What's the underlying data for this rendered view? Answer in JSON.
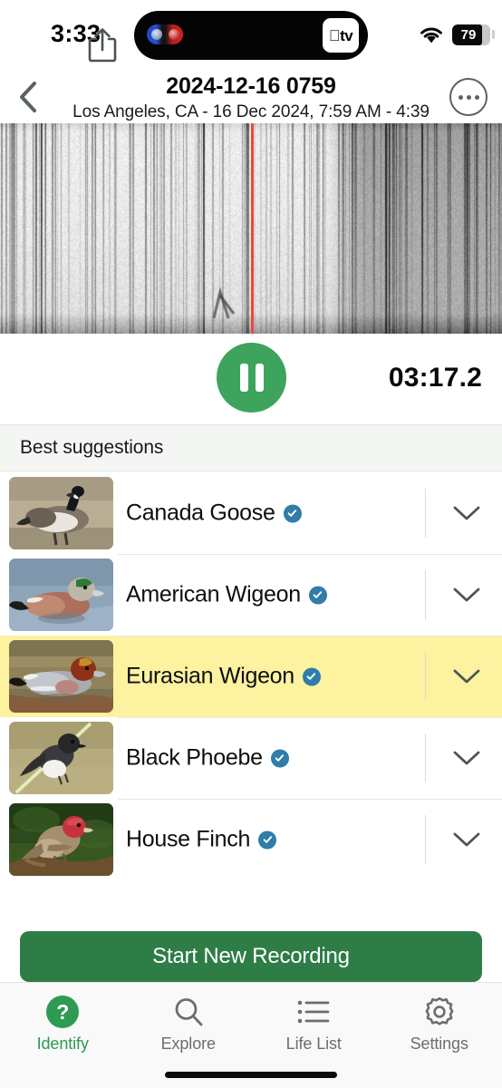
{
  "status_bar": {
    "time": "3:33",
    "dynamic_island": {
      "left_icon": "sports-teams-icon",
      "right_badge_label": "tv",
      "right_badge_icon": "apple-logo-icon"
    },
    "wifi_icon": "wifi-icon",
    "battery_percent": "79",
    "battery_level": 79
  },
  "nav": {
    "back_icon": "chevron-left-icon",
    "title": "2024-12-16 0759",
    "subtitle": "Los Angeles, CA - 16 Dec 2024, 7:59 AM - 4:39",
    "more_icon": "more-options-icon"
  },
  "spectrogram": {
    "playhead_position_pct": 50,
    "playhead_color": "#f0453f"
  },
  "transport": {
    "share_icon": "share-icon",
    "play_state": "playing",
    "pause_icon": "pause-icon",
    "elapsed": "03:17.2",
    "play_button_color": "#3da35d"
  },
  "suggestions": {
    "header": "Best suggestions",
    "verified_badge_color": "#2f7da8",
    "highlight_color": "#fcf2a0",
    "items": [
      {
        "name": "Canada Goose",
        "verified": true,
        "highlighted": false,
        "thumb": "canada-goose-photo",
        "chevron": "chevron-down-icon"
      },
      {
        "name": "American Wigeon",
        "verified": true,
        "highlighted": false,
        "thumb": "american-wigeon-photo",
        "chevron": "chevron-down-icon"
      },
      {
        "name": "Eurasian Wigeon",
        "verified": true,
        "highlighted": true,
        "thumb": "eurasian-wigeon-photo",
        "chevron": "chevron-down-icon"
      },
      {
        "name": "Black Phoebe",
        "verified": true,
        "highlighted": false,
        "thumb": "black-phoebe-photo",
        "chevron": "chevron-down-icon"
      },
      {
        "name": "House Finch",
        "verified": true,
        "highlighted": false,
        "thumb": "house-finch-photo",
        "chevron": "chevron-down-icon"
      }
    ]
  },
  "cta": {
    "label": "Start New Recording",
    "color": "#2e7d47"
  },
  "tabbar": {
    "active_color": "#2e9a52",
    "inactive_color": "#6b6f6c",
    "items": [
      {
        "label": "Identify",
        "icon": "question-mark-circle-icon",
        "active": true
      },
      {
        "label": "Explore",
        "icon": "magnifier-icon",
        "active": false
      },
      {
        "label": "Life List",
        "icon": "list-icon",
        "active": false
      },
      {
        "label": "Settings",
        "icon": "gear-icon",
        "active": false
      }
    ]
  }
}
